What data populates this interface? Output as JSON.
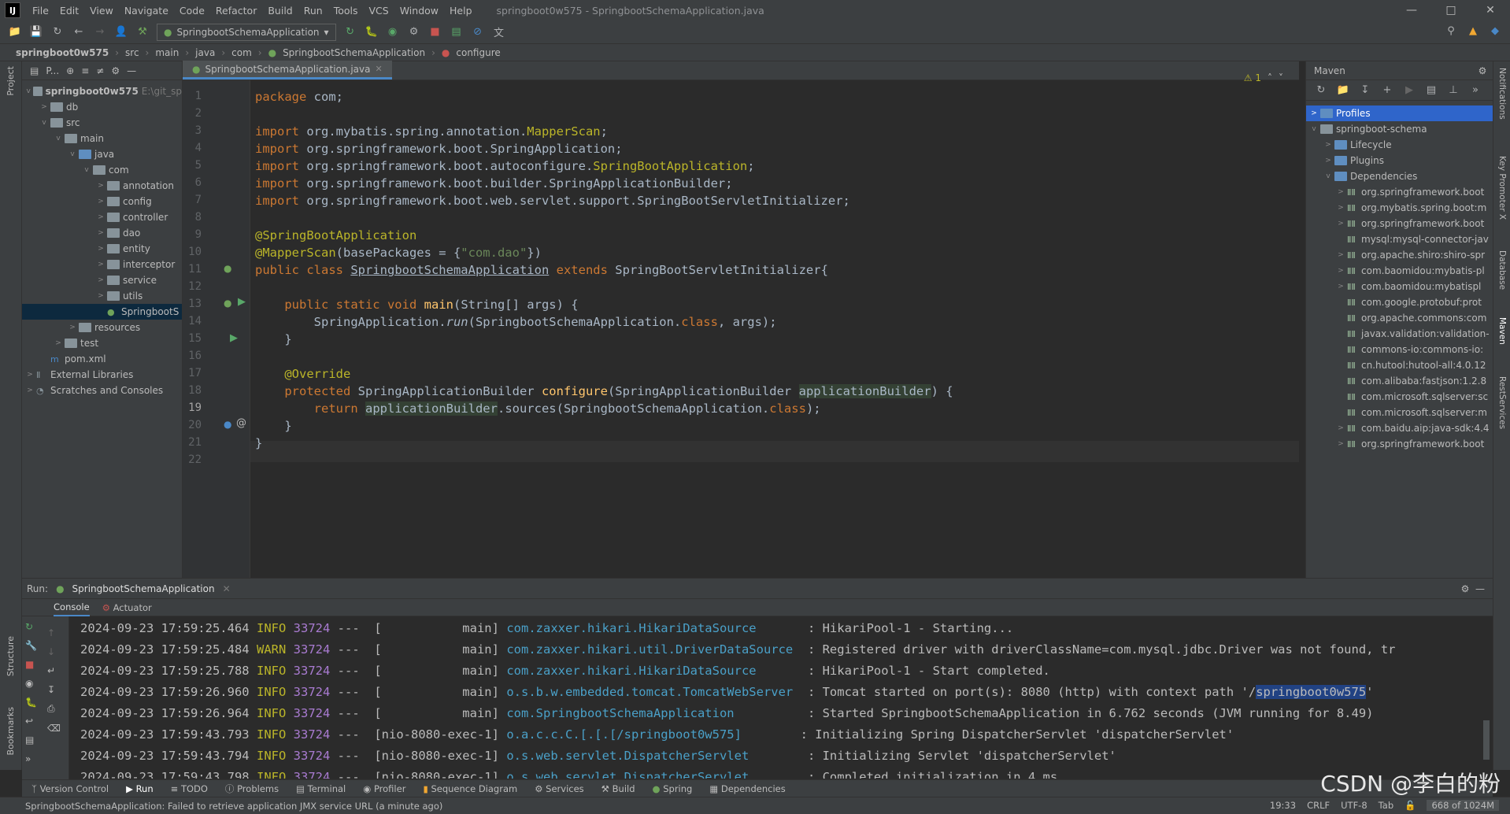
{
  "menubar": {
    "logo": "IJ",
    "items": [
      "File",
      "Edit",
      "View",
      "Navigate",
      "Code",
      "Refactor",
      "Build",
      "Run",
      "Tools",
      "VCS",
      "Window",
      "Help"
    ],
    "window_title": "springboot0w575 - SpringbootSchemaApplication.java"
  },
  "toolbar": {
    "run_config": "SpringbootSchemaApplication"
  },
  "breadcrumb": [
    "springboot0w575",
    "src",
    "main",
    "java",
    "com",
    "SpringbootSchemaApplication",
    "configure"
  ],
  "project": {
    "title": "P...",
    "root": "springboot0w575",
    "root_path": "E:\\git_sp",
    "nodes": [
      {
        "label": "db",
        "depth": 1,
        "arrow": ">"
      },
      {
        "label": "src",
        "depth": 1,
        "arrow": "v"
      },
      {
        "label": "main",
        "depth": 2,
        "arrow": "v"
      },
      {
        "label": "java",
        "depth": 3,
        "arrow": "v",
        "blue": true
      },
      {
        "label": "com",
        "depth": 4,
        "arrow": "v"
      },
      {
        "label": "annotation",
        "depth": 5,
        "arrow": ">"
      },
      {
        "label": "config",
        "depth": 5,
        "arrow": ">"
      },
      {
        "label": "controller",
        "depth": 5,
        "arrow": ">"
      },
      {
        "label": "dao",
        "depth": 5,
        "arrow": ">"
      },
      {
        "label": "entity",
        "depth": 5,
        "arrow": ">"
      },
      {
        "label": "interceptor",
        "depth": 5,
        "arrow": ">"
      },
      {
        "label": "service",
        "depth": 5,
        "arrow": ">"
      },
      {
        "label": "utils",
        "depth": 5,
        "arrow": ">"
      },
      {
        "label": "SpringbootS",
        "depth": 5,
        "arrow": "",
        "selected": true
      },
      {
        "label": "resources",
        "depth": 3,
        "arrow": ">"
      },
      {
        "label": "test",
        "depth": 2,
        "arrow": ">"
      },
      {
        "label": "pom.xml",
        "depth": 1,
        "arrow": ""
      },
      {
        "label": "External Libraries",
        "depth": 0,
        "arrow": ">"
      },
      {
        "label": "Scratches and Consoles",
        "depth": 0,
        "arrow": ">"
      }
    ]
  },
  "editor": {
    "tab": "SpringbootSchemaApplication.java",
    "warning": "⚠ 1",
    "current_line": 19,
    "line_numbers": [
      "1",
      "2",
      "3",
      "4",
      "5",
      "6",
      "7",
      "8",
      "9",
      "10",
      "11",
      "12",
      "13",
      "14",
      "15",
      "16",
      "17",
      "18",
      "19",
      "20",
      "21",
      "22"
    ]
  },
  "maven": {
    "title": "Maven",
    "profiles": "Profiles",
    "project": "springboot-schema",
    "lifecycle": "Lifecycle",
    "plugins": "Plugins",
    "dependencies": "Dependencies",
    "deps": [
      {
        "label": "org.springframework.boot",
        "arrow": ">"
      },
      {
        "label": "org.mybatis.spring.boot:m",
        "arrow": ">"
      },
      {
        "label": "org.springframework.boot",
        "arrow": ">"
      },
      {
        "label": "mysql:mysql-connector-jav",
        "arrow": ""
      },
      {
        "label": "org.apache.shiro:shiro-spr",
        "arrow": ">"
      },
      {
        "label": "com.baomidou:mybatis-pl",
        "arrow": ">"
      },
      {
        "label": "com.baomidou:mybatispl",
        "arrow": ">"
      },
      {
        "label": "com.google.protobuf:prot",
        "arrow": ""
      },
      {
        "label": "org.apache.commons:com",
        "arrow": ""
      },
      {
        "label": "javax.validation:validation-",
        "arrow": ""
      },
      {
        "label": "commons-io:commons-io:",
        "arrow": ""
      },
      {
        "label": "cn.hutool:hutool-all:4.0.12",
        "arrow": ""
      },
      {
        "label": "com.alibaba:fastjson:1.2.8",
        "arrow": ""
      },
      {
        "label": "com.microsoft.sqlserver:sc",
        "arrow": ""
      },
      {
        "label": "com.microsoft.sqlserver:m",
        "arrow": ""
      },
      {
        "label": "com.baidu.aip:java-sdk:4.4",
        "arrow": ">"
      },
      {
        "label": "org.springframework.boot",
        "arrow": ">"
      }
    ]
  },
  "right_stripe": [
    "Notifications",
    "Key Promoter X",
    "Database",
    "Maven",
    "RestServices"
  ],
  "left_stripe": [
    "Project",
    "Structure",
    "Bookmarks"
  ],
  "run": {
    "label": "Run:",
    "tab": "SpringbootSchemaApplication",
    "console": "Console",
    "actuator": "Actuator",
    "logs": [
      {
        "ts": "2024-09-23 17:59:25.464",
        "lvl": "INFO",
        "pid": "33724",
        "thread": "---  [           main]",
        "cls": "com.zaxxer.hikari.HikariDataSource      ",
        "msg": " : HikariPool-1 - Starting..."
      },
      {
        "ts": "2024-09-23 17:59:25.484",
        "lvl": "WARN",
        "pid": "33724",
        "thread": "---  [           main]",
        "cls": "com.zaxxer.hikari.util.DriverDataSource ",
        "msg": " : Registered driver with driverClassName=com.mysql.jdbc.Driver was not found, tr"
      },
      {
        "ts": "2024-09-23 17:59:25.788",
        "lvl": "INFO",
        "pid": "33724",
        "thread": "---  [           main]",
        "cls": "com.zaxxer.hikari.HikariDataSource      ",
        "msg": " : HikariPool-1 - Start completed."
      },
      {
        "ts": "2024-09-23 17:59:26.960",
        "lvl": "INFO",
        "pid": "33724",
        "thread": "---  [           main]",
        "cls": "o.s.b.w.embedded.tomcat.TomcatWebServer ",
        "msg": " : Tomcat started on port(s): 8080 (http) with context path '/",
        "hl": "springboot0w575",
        "msg2": "'"
      },
      {
        "ts": "2024-09-23 17:59:26.964",
        "lvl": "INFO",
        "pid": "33724",
        "thread": "---  [           main]",
        "cls": "com.SpringbootSchemaApplication         ",
        "msg": " : Started SpringbootSchemaApplication in 6.762 seconds (JVM running for 8.49)"
      },
      {
        "ts": "2024-09-23 17:59:43.793",
        "lvl": "INFO",
        "pid": "33724",
        "thread": "---  [nio-8080-exec-1]",
        "cls": "o.a.c.c.C.[.[.[/springboot0w575]       ",
        "msg": " : Initializing Spring DispatcherServlet 'dispatcherServlet'"
      },
      {
        "ts": "2024-09-23 17:59:43.794",
        "lvl": "INFO",
        "pid": "33724",
        "thread": "---  [nio-8080-exec-1]",
        "cls": "o.s.web.servlet.DispatcherServlet       ",
        "msg": " : Initializing Servlet 'dispatcherServlet'"
      },
      {
        "ts": "2024-09-23 17:59:43.798",
        "lvl": "INFO",
        "pid": "33724",
        "thread": "---  [nio-8080-exec-1]",
        "cls": "o.s.web.servlet.DispatcherServlet       ",
        "msg": " : Completed initialization in 4 ms"
      }
    ]
  },
  "bottom_tabs": [
    "Version Control",
    "Run",
    "TODO",
    "Problems",
    "Terminal",
    "Profiler",
    "Sequence Diagram",
    "Services",
    "Build",
    "Spring",
    "Dependencies"
  ],
  "status": {
    "message": "SpringbootSchemaApplication: Failed to retrieve application JMX service URL (a minute ago)",
    "position": "19:33",
    "line_sep": "CRLF",
    "encoding": "UTF-8",
    "indent": "Tab",
    "memory": "668 of 1024M"
  },
  "watermark": "CSDN @李白的粉"
}
